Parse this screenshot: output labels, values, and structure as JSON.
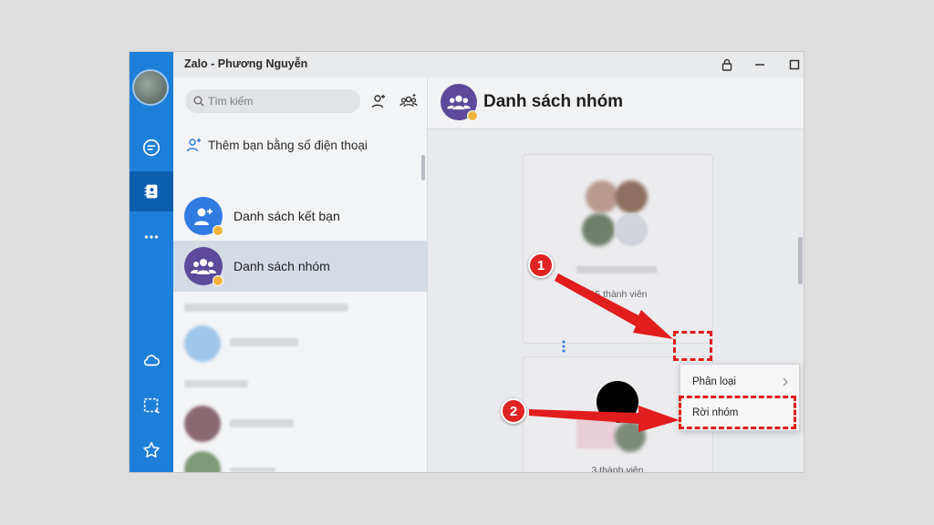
{
  "window": {
    "title": "Zalo - Phương Nguyễn"
  },
  "search": {
    "placeholder": "Tìm kiếm"
  },
  "contacts": {
    "add_by_phone": "Thêm bạn bằng số điện thoại",
    "items": [
      {
        "label": "Danh sách kết bạn",
        "icon": "add-person-icon",
        "color": "#2f7be0"
      },
      {
        "label": "Danh sách nhóm",
        "icon": "group-icon",
        "color": "#5d4a9a"
      }
    ]
  },
  "main": {
    "title": "Danh sách nhóm",
    "groups": [
      {
        "members": "15 thành viên"
      },
      {
        "members": "3 thành viên"
      }
    ]
  },
  "context_menu": {
    "items": [
      {
        "label": "Phân loại",
        "has_submenu": true
      },
      {
        "label": "Rời nhóm",
        "has_submenu": false
      }
    ]
  },
  "steps": [
    "1",
    "2"
  ],
  "colors": {
    "sidebar": "#1e7fd9",
    "accent": "#2f7be0",
    "highlight": "#e11d1d"
  }
}
